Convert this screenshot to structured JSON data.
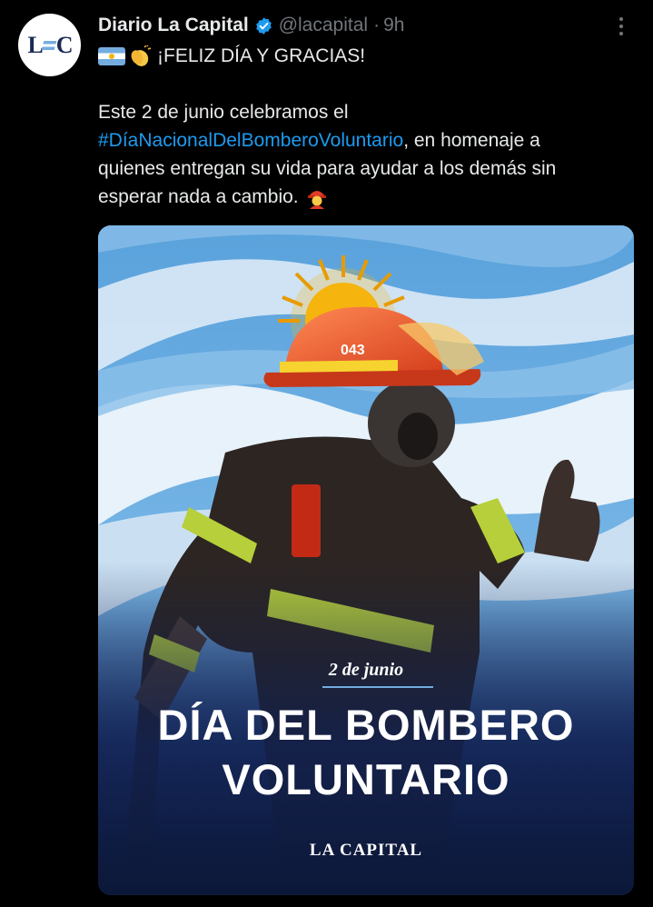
{
  "account": {
    "display_name": "Diario La Capital",
    "handle": "@lacapital",
    "separator": "·",
    "time": "9h",
    "avatar_text": "LC"
  },
  "tweet": {
    "headline": "¡FELIZ DÍA Y GRACIAS!",
    "body_line1": "Este 2 de junio celebramos el",
    "hashtag": "#DíaNacionalDelBomberoVoluntario",
    "body_line2_rest": ", en homenaje a",
    "body_line3": "quienes entregan su vida para ayudar a los demás sin",
    "body_line4": "esperar nada a cambio."
  },
  "media": {
    "helmet_number": "043",
    "date_label": "2 de junio",
    "title_line1": "DÍA DEL BOMBERO",
    "title_line2": "VOLUNTARIO",
    "brand": "LA CAPITAL"
  },
  "icons": {
    "verified": "verified-badge-icon",
    "more": "more-options-icon",
    "flag": "argentina-flag-emoji",
    "clap": "clapping-hands-emoji",
    "firefighter": "firefighter-emoji"
  },
  "colors": {
    "background": "#000000",
    "text": "#e7e9ea",
    "muted": "#71767b",
    "link": "#1d9bf0",
    "flag_blue": "#74acdf",
    "sun": "#f6b40e"
  }
}
